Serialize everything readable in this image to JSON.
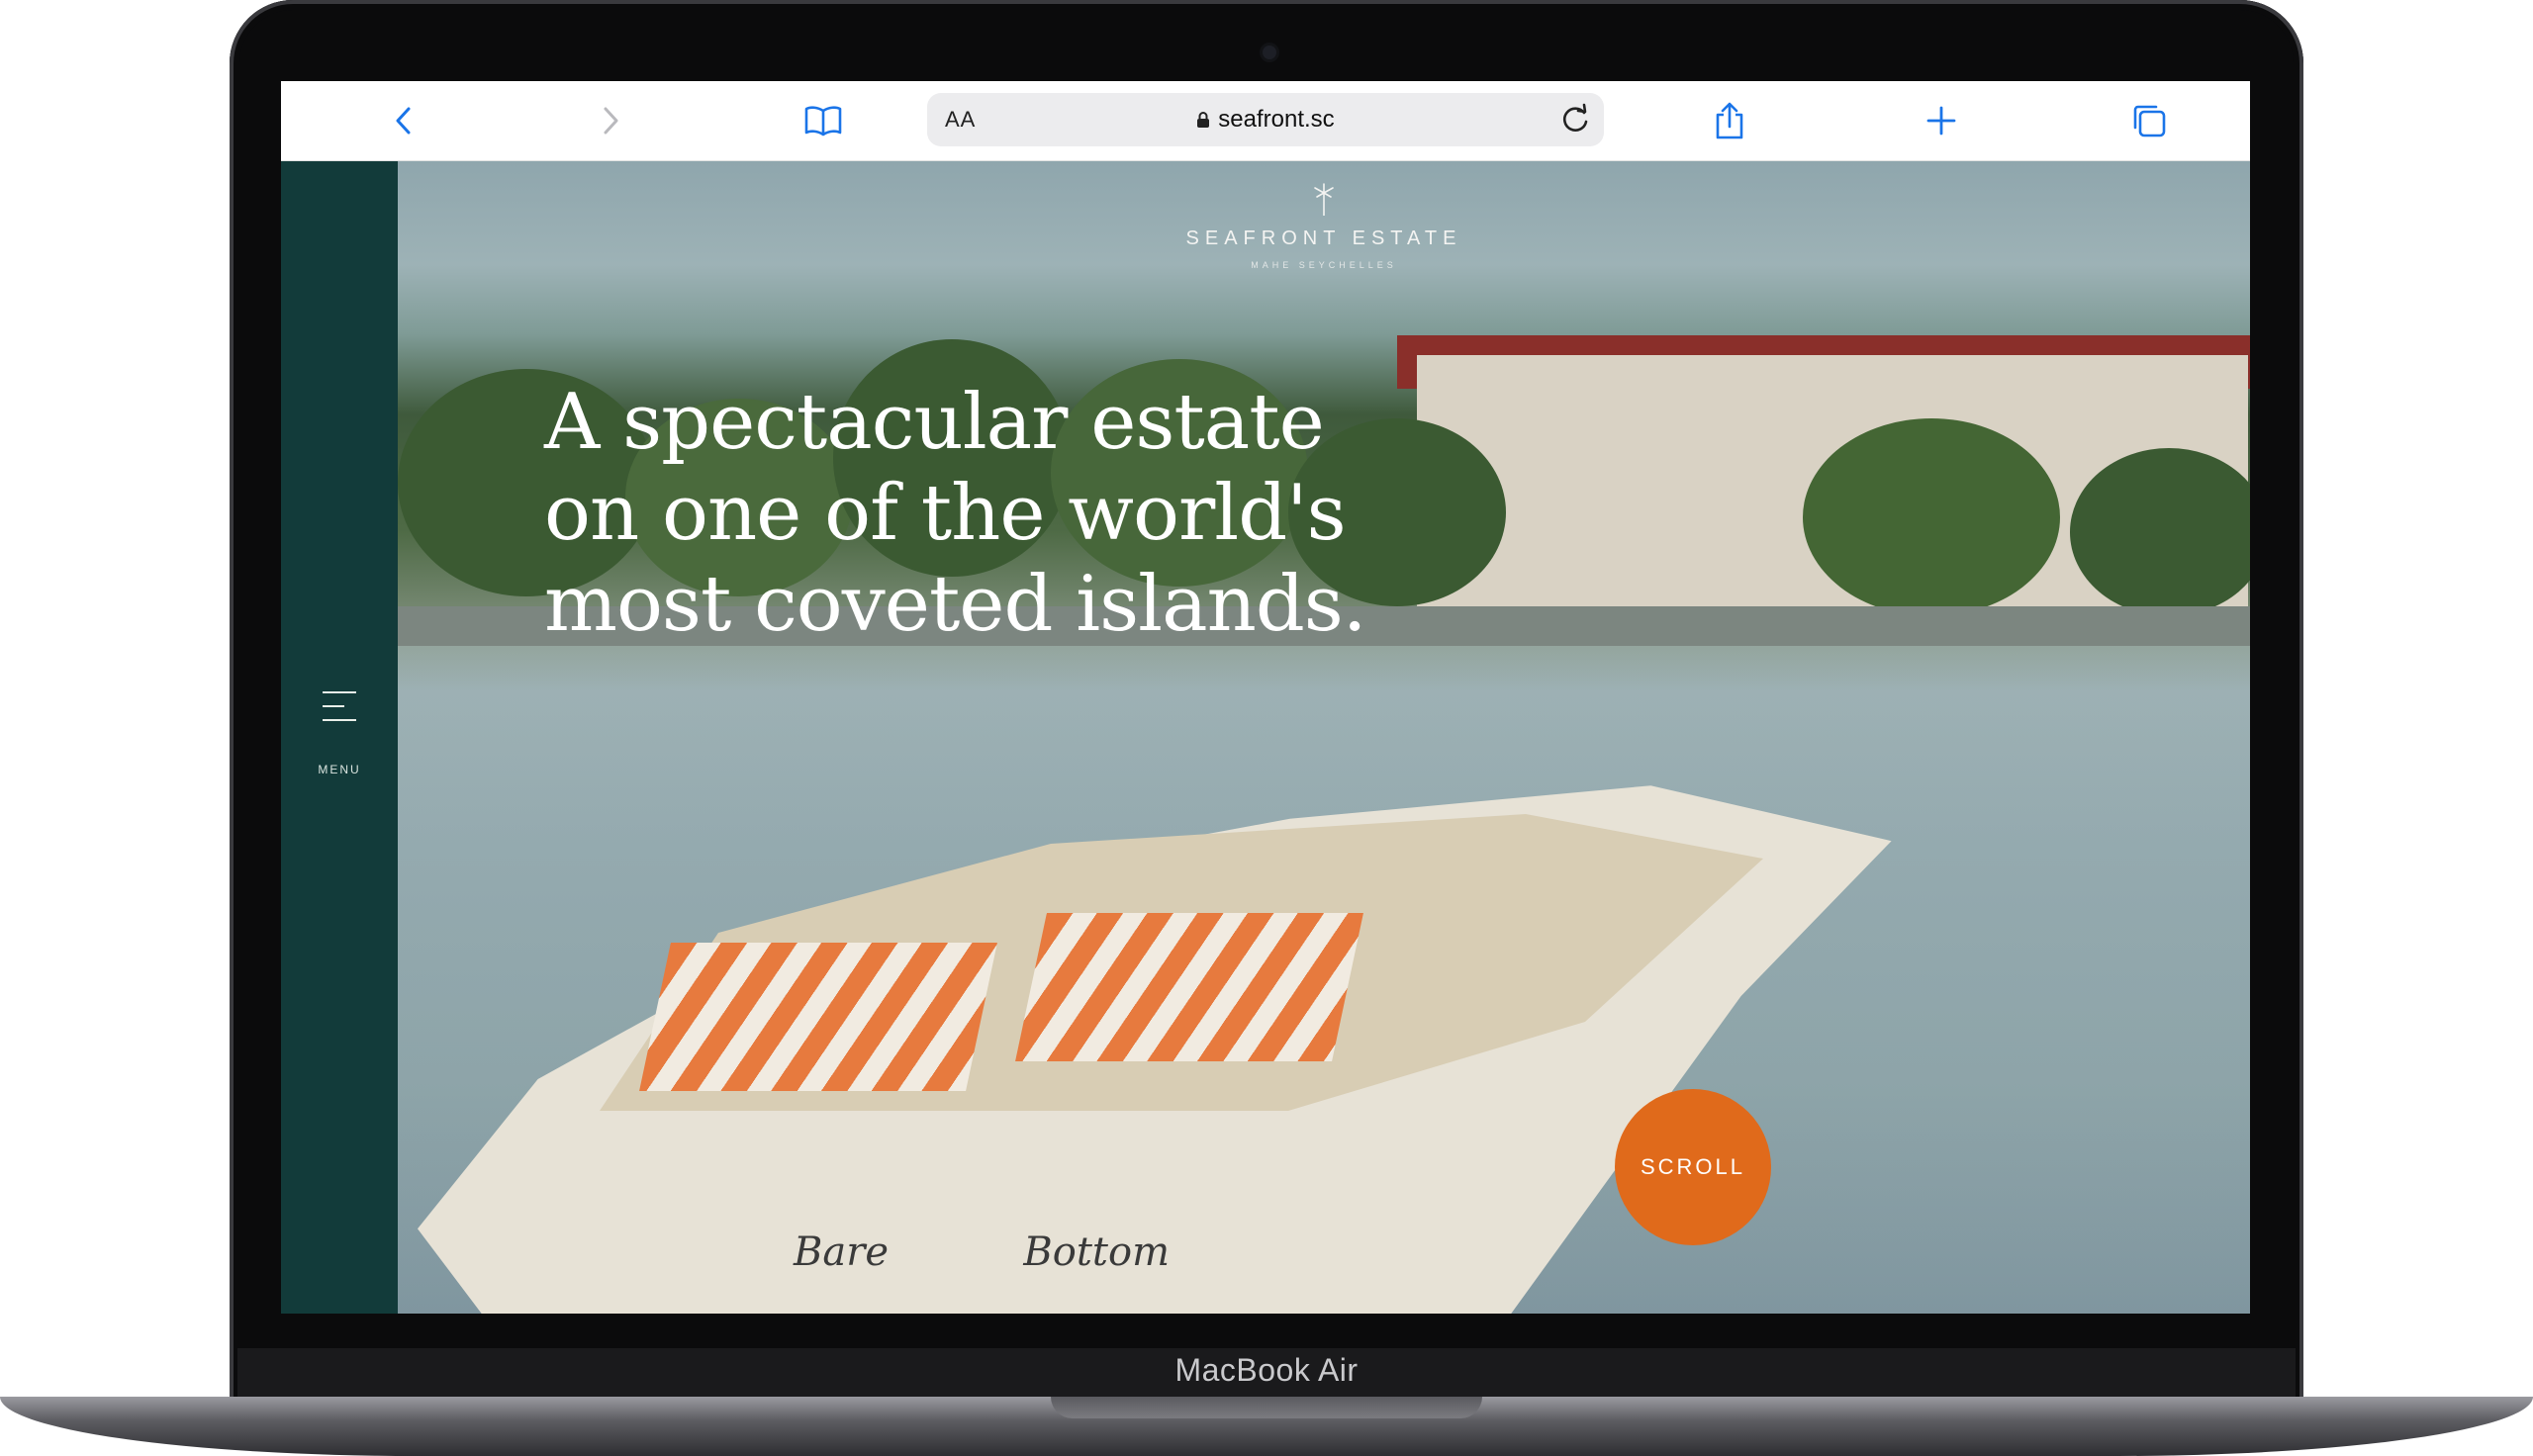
{
  "device": {
    "label": "MacBook Air"
  },
  "browser": {
    "text_size_label": "AA",
    "url": "seafront.sc"
  },
  "site": {
    "logo_name": "SEAFRONT ESTATE",
    "logo_subtitle": "MAHE SEYCHELLES",
    "menu_label": "MENU",
    "headline_lines": [
      "A spectacular estate",
      "on one of the world's",
      "most coveted islands."
    ],
    "scroll_label": "SCROLL",
    "boat_name_left": "Bare",
    "boat_name_right": "Bottom"
  },
  "colors": {
    "sidebar": "#123b3a",
    "scroll_button": "#e06a1b",
    "toolbar_icon": "#1a74e8"
  },
  "icons": [
    "back-icon",
    "forward-icon",
    "bookmarks-icon",
    "lock-icon",
    "reload-icon",
    "share-icon",
    "new-tab-icon",
    "tabs-icon",
    "palm-logo-icon",
    "hamburger-icon"
  ]
}
